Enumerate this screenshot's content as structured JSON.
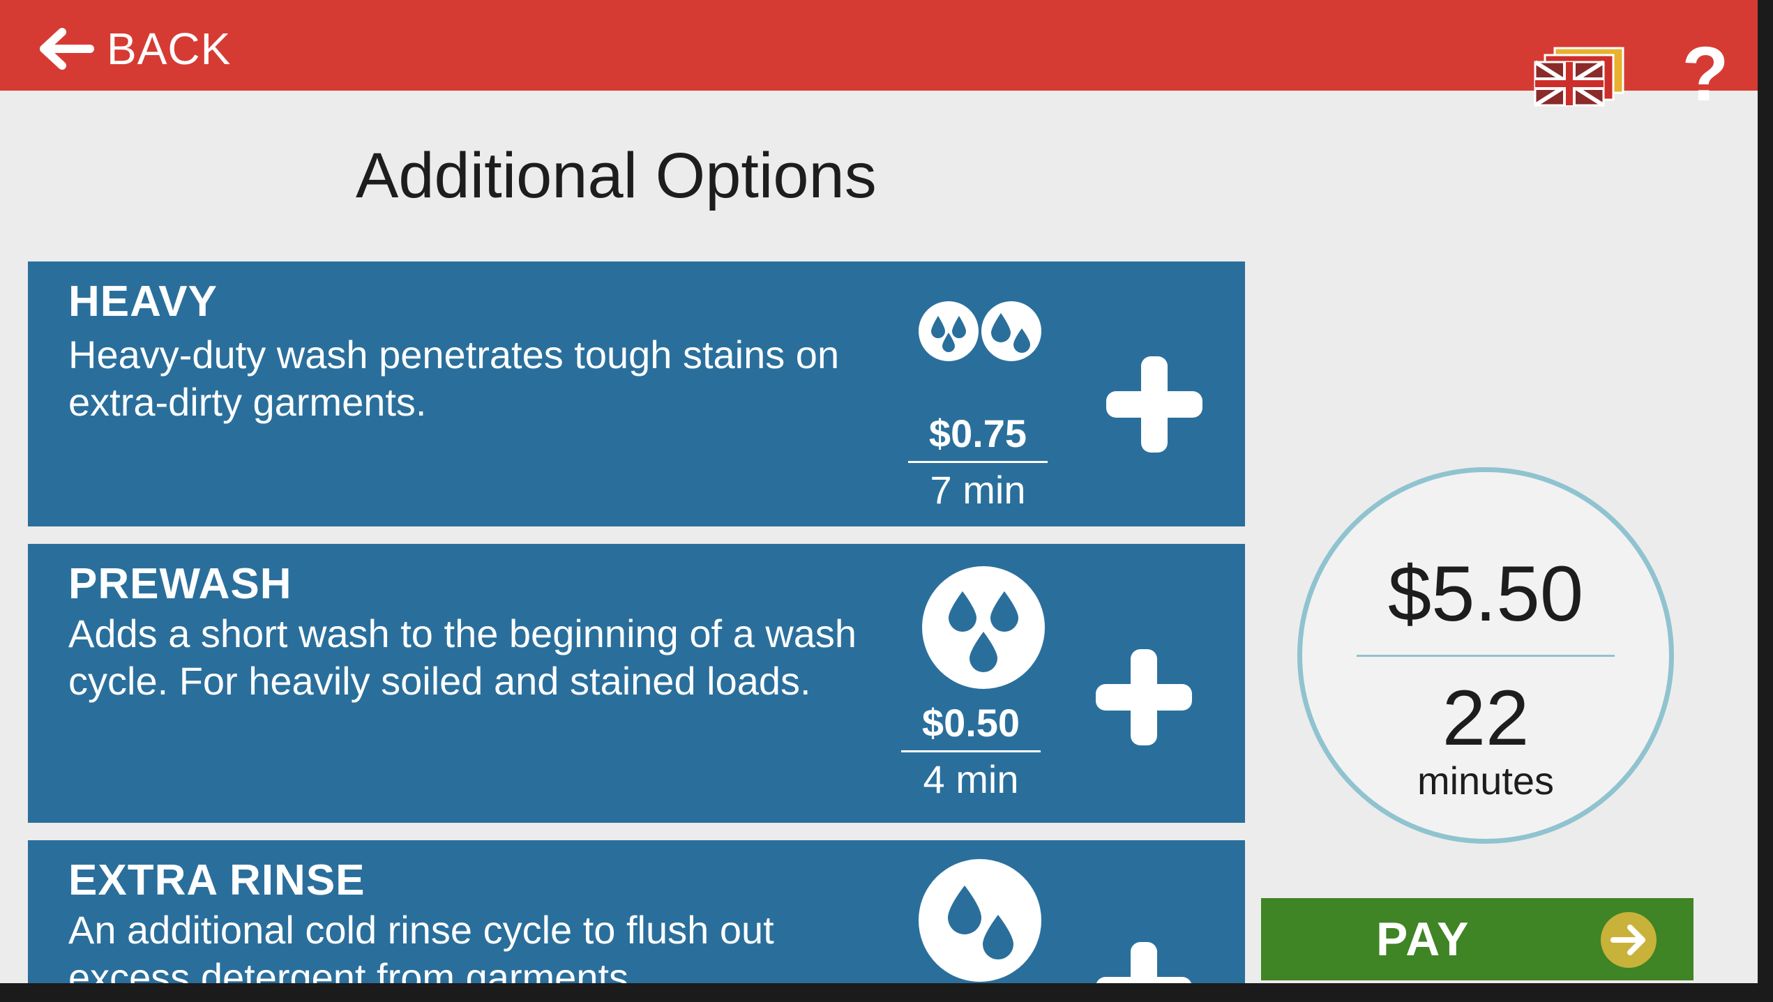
{
  "header": {
    "back_label": "BACK",
    "help_label": "?",
    "color": "#d63b33"
  },
  "page_title": "Additional Options",
  "options": [
    {
      "name": "HEAVY",
      "description": "Heavy-duty wash penetrates tough stains on extra-dirty garments.",
      "price": "$0.75",
      "time": "7 min",
      "icon": "double-water-drops-icon"
    },
    {
      "name": "PREWASH",
      "description": "Adds a short wash to the beginning of a wash cycle. For heavily soiled and stained loads.",
      "price": "$0.50",
      "time": "4 min",
      "icon": "three-water-drops-icon"
    },
    {
      "name": "EXTRA RINSE",
      "description": "An additional cold rinse cycle to flush out excess detergent from garments.",
      "icon": "two-water-drops-icon"
    }
  ],
  "summary": {
    "total_price": "$5.50",
    "total_minutes": "22",
    "minutes_unit": "minutes"
  },
  "pay": {
    "label": "PAY",
    "color": "#3f8425"
  },
  "colors": {
    "option_bg": "#2a6f9c",
    "summary_ring": "#8fc3cf"
  }
}
